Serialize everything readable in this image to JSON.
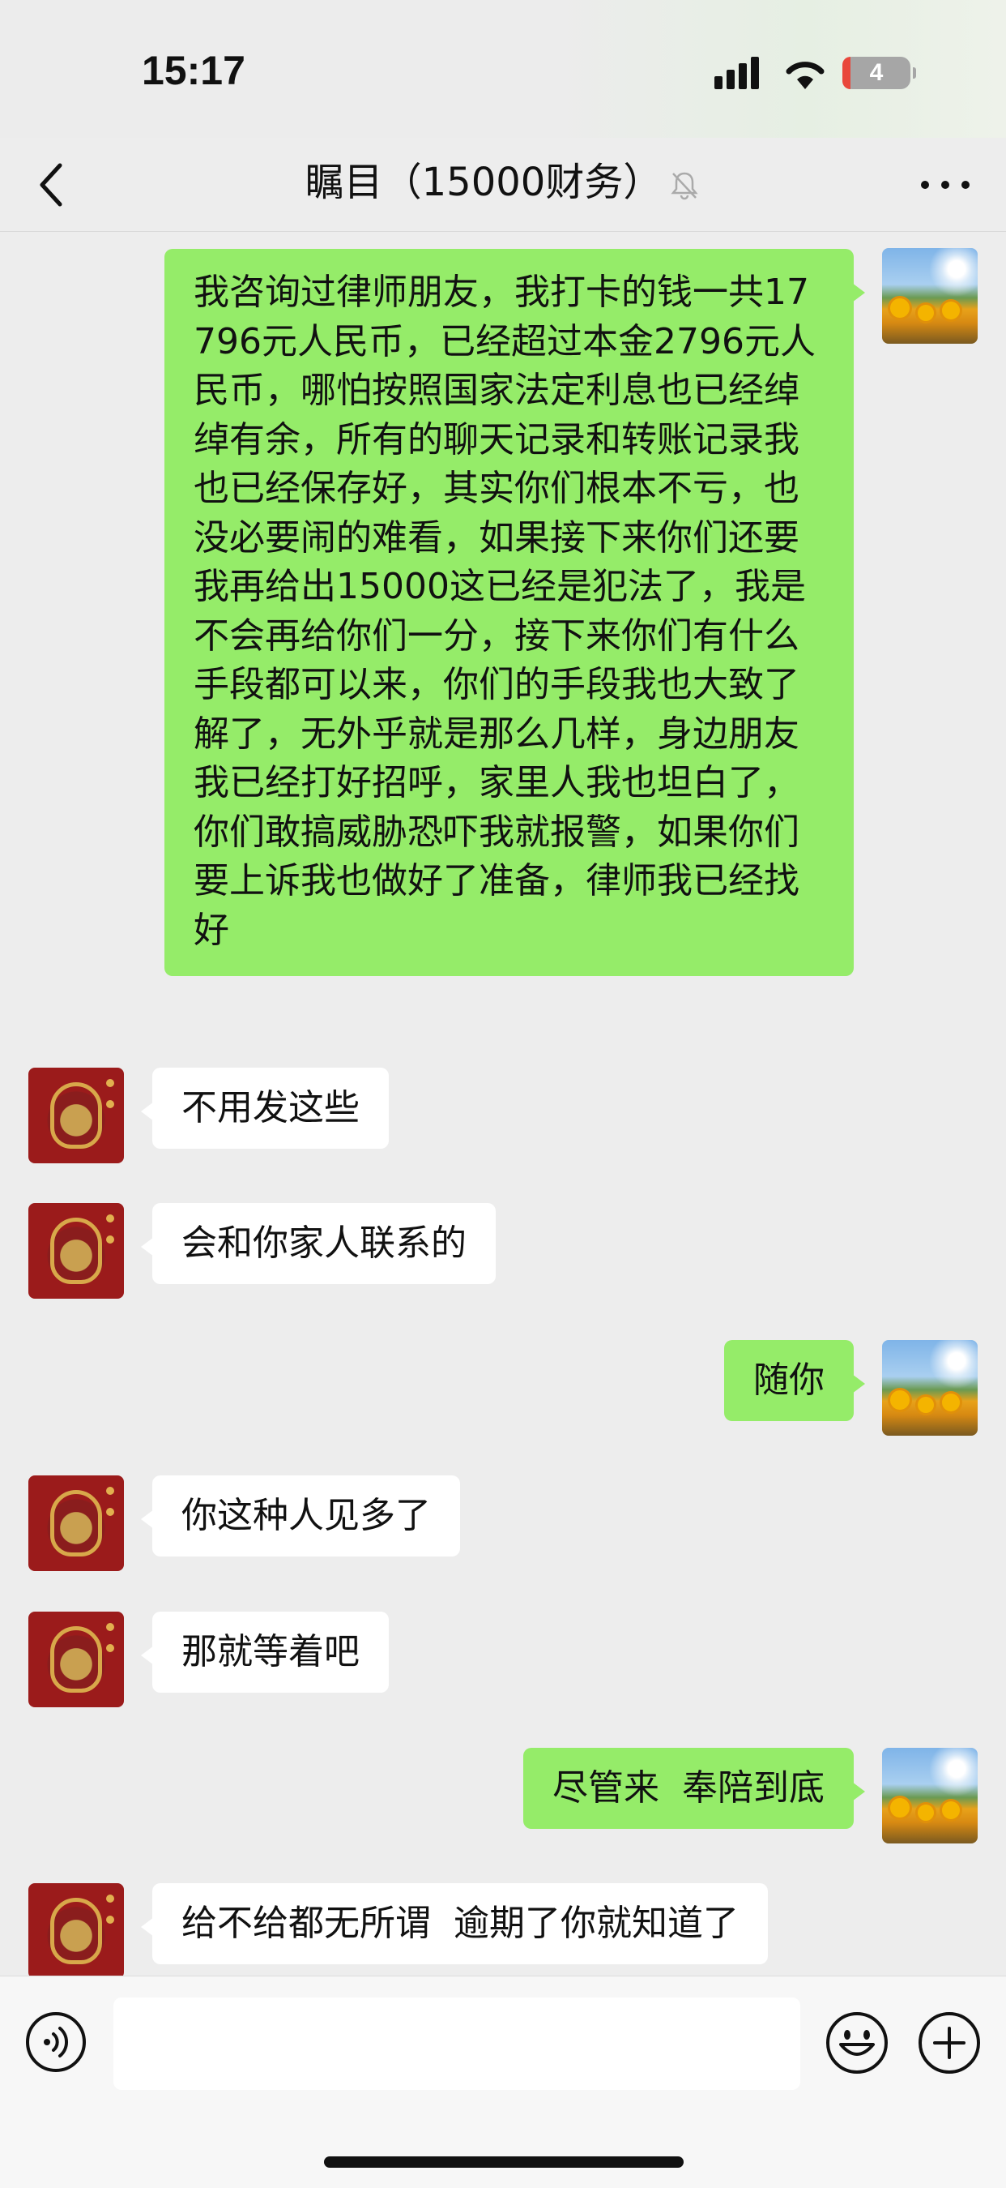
{
  "status_bar": {
    "time": "15:17",
    "battery_level": "4",
    "icons": [
      "signal-icon",
      "wifi-icon",
      "battery-icon"
    ]
  },
  "nav": {
    "title": "瞩目（15000财务）",
    "icons": [
      "back-icon",
      "mute-bell-icon",
      "more-icon"
    ]
  },
  "colors": {
    "my_bubble": "#95ec69",
    "other_bubble": "#ffffff",
    "background": "#ededed"
  },
  "messages": [
    {
      "sender": "me",
      "text": "我咨询过律师朋友，我打卡的钱一共17796元人民币，已经超过本金2796元人民币，哪怕按照国家法定利息也已经绰绰有余，所有的聊天记录和转账记录我也已经保存好，其实你们根本不亏，也没必要闹的难看，如果接下来你们还要我再给出15000这已经是犯法了，我是不会再给你们一分，接下来你们有什么手段都可以来，你们的手段我也大致了解了，无外乎就是那么几样，身边朋友我已经打好招呼，家里人我也坦白了，你们敢搞威胁恐吓我就报警，如果你们要上诉我也做好了准备，律师我已经找好"
    },
    {
      "sender": "other",
      "text": "不用发这些"
    },
    {
      "sender": "other",
      "text": "会和你家人联系的"
    },
    {
      "sender": "me",
      "text": "随你"
    },
    {
      "sender": "other",
      "text": "你这种人见多了"
    },
    {
      "sender": "other",
      "text": "那就等着吧"
    },
    {
      "sender": "me",
      "text": "尽管来  奉陪到底"
    },
    {
      "sender": "other",
      "text": "给不给都无所谓  逾期了你就知道了"
    }
  ],
  "input": {
    "value": "",
    "icons": [
      "voice-icon",
      "emoji-icon",
      "plus-icon"
    ]
  }
}
